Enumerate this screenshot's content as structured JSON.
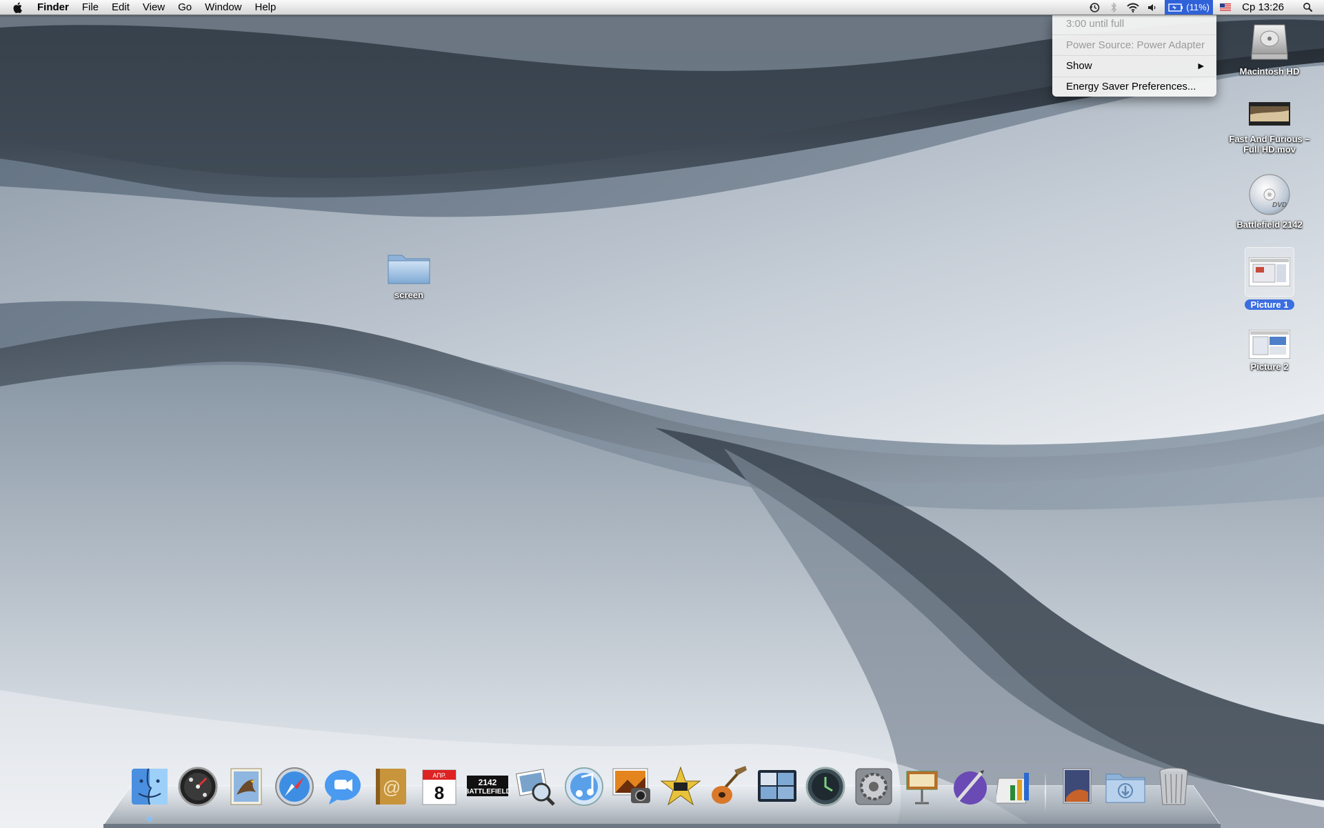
{
  "menubar": {
    "app_name": "Finder",
    "menus": [
      "File",
      "Edit",
      "View",
      "Go",
      "Window",
      "Help"
    ],
    "battery_percent": "(11%)",
    "clock": "Ср 13:26"
  },
  "battery_menu": {
    "time_status": "3:00 until full",
    "power_source": "Power Source: Power Adapter",
    "show_label": "Show",
    "preferences_label": "Energy Saver Preferences..."
  },
  "desktop_icons": [
    {
      "name": "Macintosh HD"
    },
    {
      "name_line1": "Fast And Furious –",
      "name_line2": "Full HD.mov"
    },
    {
      "name": "Battlefield 2142"
    },
    {
      "name": "Picture 1"
    },
    {
      "name": "Picture 2"
    },
    {
      "name": "screen"
    }
  ],
  "dock": {
    "items": [
      {
        "icon": "finder-icon",
        "running": true
      },
      {
        "icon": "dashboard-icon"
      },
      {
        "icon": "mail-icon"
      },
      {
        "icon": "safari-icon"
      },
      {
        "icon": "ichat-icon"
      },
      {
        "icon": "address-book-icon"
      },
      {
        "icon": "ical-icon",
        "month": "АПР.",
        "day": "8"
      },
      {
        "icon": "battlefield-2142-icon",
        "text_top": "2142",
        "text_bottom": "BATTLEFIELD"
      },
      {
        "icon": "preview-icon"
      },
      {
        "icon": "itunes-icon"
      },
      {
        "icon": "iphoto-icon"
      },
      {
        "icon": "imovie-icon"
      },
      {
        "icon": "garageband-icon"
      },
      {
        "icon": "spaces-icon"
      },
      {
        "icon": "time-machine-icon"
      },
      {
        "icon": "system-preferences-icon"
      },
      {
        "icon": "keynote-icon"
      },
      {
        "icon": "iweb-icon"
      },
      {
        "icon": "numbers-icon"
      },
      {
        "icon": "documents-stack-icon"
      },
      {
        "icon": "downloads-stack-icon"
      },
      {
        "icon": "trash-icon"
      }
    ]
  },
  "colors": {
    "menu_highlight": "#2f62d9",
    "selection_label": "#3b6ee0"
  }
}
